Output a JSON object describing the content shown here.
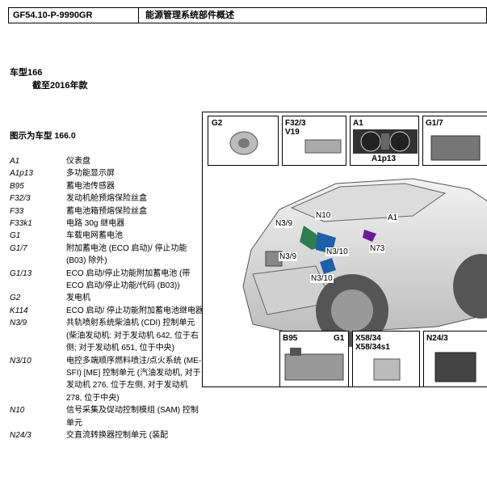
{
  "header": {
    "code": "GF54.10-P-9990GR",
    "title": "能源管理系统部件概述"
  },
  "model": {
    "line1": "车型166",
    "line2": "截至2016年款"
  },
  "figure_title": "图示为车型 166.0",
  "legend": [
    {
      "key": "A1",
      "value": "仪表盘"
    },
    {
      "key": "A1p13",
      "value": "多功能显示屏"
    },
    {
      "key": "B95",
      "value": "蓄电池传感器"
    },
    {
      "key": "F32/3",
      "value": "发动机舱预熔保险丝盒"
    },
    {
      "key": "F33",
      "value": "蓄电池箱预熔保险丝盒"
    },
    {
      "key": "F33k1",
      "value": "电路 30g 继电器"
    },
    {
      "key": "G1",
      "value": "车载电网蓄电池"
    },
    {
      "key": "G1/7",
      "value": "附加蓄电池 (ECO 启动)/ 停止功能(B03) 除外)"
    },
    {
      "key": "G1/13",
      "value": "ECO 启动/停止功能附加蓄电池 (带 ECO 启动/停止功能/代码 (B03))"
    },
    {
      "key": "G2",
      "value": "发电机"
    },
    {
      "key": "K114",
      "value": "ECO 启动/ 停止功能附加蓄电池继电器"
    },
    {
      "key": "N3/9",
      "value": "共轨喷射系统柴油机 (CDI) 控制单元 (柴油发动机: 对于发动机 642, 位于右侧; 对于发动机 651, 位于中央)"
    },
    {
      "key": "N3/10",
      "value": "电控多端顺序燃料喷注/点火系统 (ME-SFI) [ME] 控制单元 (汽油发动机, 对于发动机 276, 位于左侧, 对于发动机 278, 位于中央)"
    },
    {
      "key": "N10",
      "value": "信号采集及促动控制模组 (SAM) 控制单元"
    },
    {
      "key": "N24/3",
      "value": "交直流转换器控制单元 (装配"
    }
  ],
  "figure": {
    "insets": {
      "g2": "G2",
      "f32": "F32/3",
      "v19": "V19",
      "a1": "A1",
      "a1p13": "A1p13",
      "g17": "G1/7",
      "b95": "B95",
      "g1": "G1",
      "x58": "X58/34",
      "x58s1": "X58/34s1",
      "n243": "N24/3"
    },
    "callouts": {
      "n39a": "N3/9",
      "n10": "N10",
      "a1": "A1",
      "n39b": "N3/9",
      "n310a": "N3/10",
      "n73": "N73",
      "n310b": "N3/10"
    }
  }
}
